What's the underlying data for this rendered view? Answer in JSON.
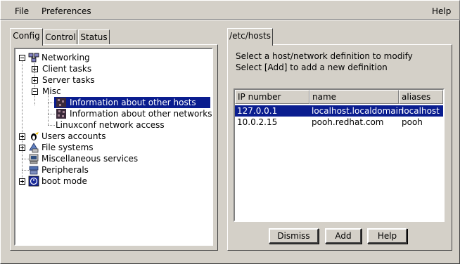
{
  "menubar": {
    "file": "File",
    "preferences": "Preferences",
    "help": "Help"
  },
  "left_tabs": [
    "Config",
    "Control",
    "Status"
  ],
  "tree": {
    "networking": "Networking",
    "client_tasks": "Client tasks",
    "server_tasks": "Server tasks",
    "misc": "Misc",
    "info_hosts": "Information about other hosts",
    "info_networks": "Information about other networks",
    "linuxconf_access": "Linuxconf network access",
    "users_accounts": "Users accounts",
    "file_systems": "File systems",
    "misc_services": "Miscellaneous services",
    "peripherals": "Peripherals",
    "boot_mode": "boot mode"
  },
  "right_tab": "/etc/hosts",
  "instructions": {
    "line1": "Select a host/network definition to modify",
    "line2": "Select [Add] to add a new definition"
  },
  "hosts_table": {
    "columns": [
      "IP number",
      "name",
      "aliases"
    ],
    "rows": [
      {
        "ip": "127.0.0.1",
        "name": "localhost.localdomain",
        "aliases": "localhost"
      },
      {
        "ip": "10.0.2.15",
        "name": "pooh.redhat.com",
        "aliases": "pooh"
      }
    ]
  },
  "buttons": {
    "dismiss": "Dismiss",
    "add": "Add",
    "help": "Help"
  },
  "colors": {
    "selection": "#0a1d8f",
    "window_bg": "#d4d0c8"
  }
}
